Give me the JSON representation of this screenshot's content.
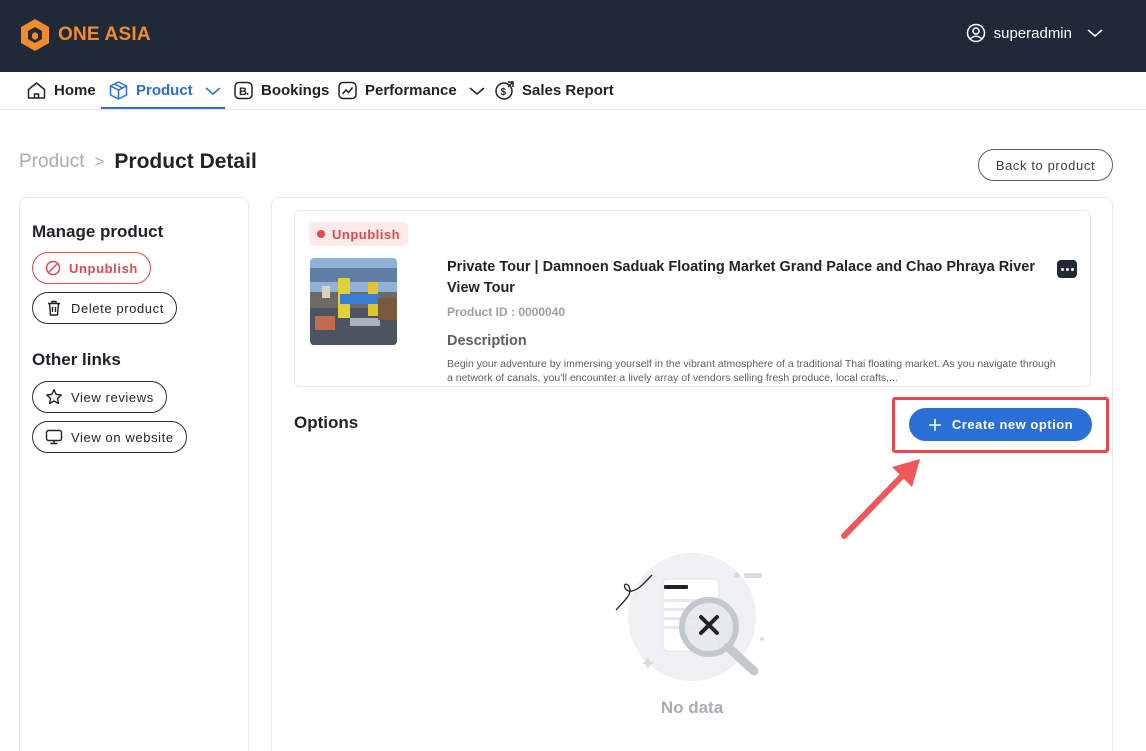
{
  "header": {
    "brand": "ONE ASIA",
    "user": "superadmin"
  },
  "nav": {
    "items": [
      {
        "label": "Home",
        "icon": "home-icon"
      },
      {
        "label": "Product",
        "icon": "box-icon",
        "active": true,
        "dropdown": true
      },
      {
        "label": "Bookings",
        "icon": "bookings-icon"
      },
      {
        "label": "Performance",
        "icon": "chart-icon",
        "dropdown": true
      },
      {
        "label": "Sales Report",
        "icon": "sales-report-icon"
      }
    ]
  },
  "breadcrumb": {
    "parent": "Product",
    "separator": ">",
    "current": "Product Detail"
  },
  "back_button": "Back to product",
  "sidebar": {
    "manage_title": "Manage product",
    "unpublish_label": "Unpublish",
    "delete_label": "Delete product",
    "links_title": "Other links",
    "reviews_label": "View reviews",
    "website_label": "View on website"
  },
  "product": {
    "status": "Unpublish",
    "title": "Private Tour | Damnoen Saduak Floating Market Grand Palace and Chao Phraya River View Tour",
    "id_label": "Product ID : 0000040",
    "description_label": "Description",
    "description": "Begin your adventure by immersing yourself in the vibrant atmosphere of a traditional Thai floating market. As you navigate through a network of canals, you'll encounter a lively array of vendors selling fresh produce, local crafts,..."
  },
  "options": {
    "title": "Options",
    "create_label": "Create new option",
    "empty_text": "No data"
  },
  "colors": {
    "topbar": "#1f2937",
    "brand": "#f28b30",
    "primary": "#2a6fd6",
    "danger": "#e5484d"
  }
}
